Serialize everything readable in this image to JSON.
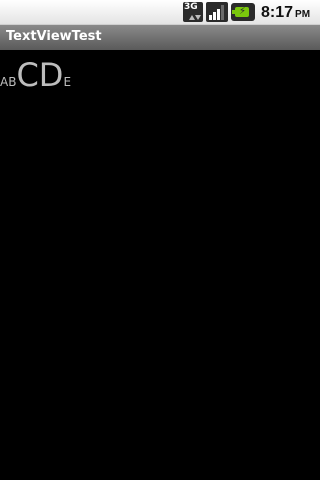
{
  "status_bar": {
    "network_label": "3G",
    "time": "8:17",
    "ampm": "PM",
    "icons": [
      "network-3g-icon",
      "signal-icon",
      "battery-charging-icon"
    ],
    "colors": {
      "battery": "#7ac70c"
    }
  },
  "title_bar": {
    "title": "TextViewTest"
  },
  "textview": {
    "segments": [
      {
        "text": "AB",
        "size": "small"
      },
      {
        "text": "CD",
        "size": "big"
      },
      {
        "text": "E",
        "size": "small"
      }
    ],
    "color": "#bdbdbd"
  }
}
